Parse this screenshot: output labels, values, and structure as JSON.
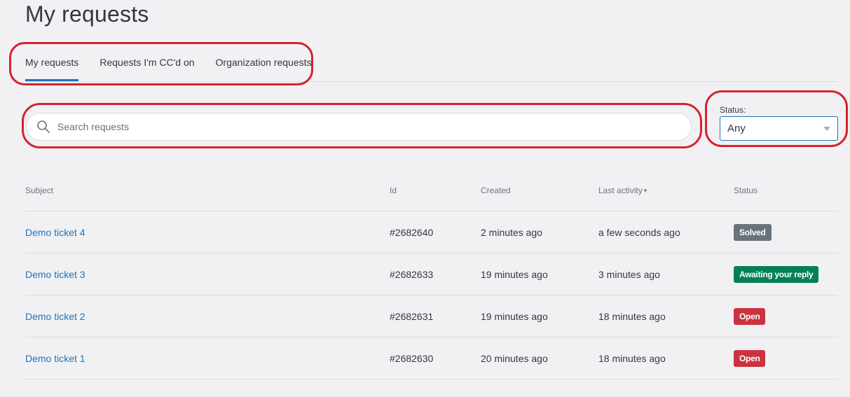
{
  "page": {
    "title": "My requests"
  },
  "tabs": [
    {
      "label": "My requests",
      "active": true
    },
    {
      "label": "Requests I'm CC'd on",
      "active": false
    },
    {
      "label": "Organization requests",
      "active": false
    }
  ],
  "search": {
    "placeholder": "Search requests",
    "value": "",
    "icon": "search-icon"
  },
  "status_filter": {
    "label": "Status:",
    "value": "Any"
  },
  "table": {
    "headers": {
      "subject": "Subject",
      "id": "Id",
      "created": "Created",
      "last_activity": "Last activity",
      "last_activity_sort": "▾",
      "status": "Status"
    },
    "rows": [
      {
        "subject": "Demo ticket 4",
        "id": "#2682640",
        "created": "2 minutes ago",
        "last_activity": "a few seconds ago",
        "status": "Solved",
        "status_color": "#68737d"
      },
      {
        "subject": "Demo ticket 3",
        "id": "#2682633",
        "created": "19 minutes ago",
        "last_activity": "3 minutes ago",
        "status": "Awaiting your reply",
        "status_color": "#038153"
      },
      {
        "subject": "Demo ticket 2",
        "id": "#2682631",
        "created": "19 minutes ago",
        "last_activity": "18 minutes ago",
        "status": "Open",
        "status_color": "#cc3340"
      },
      {
        "subject": "Demo ticket 1",
        "id": "#2682630",
        "created": "20 minutes ago",
        "last_activity": "18 minutes ago",
        "status": "Open",
        "status_color": "#cc3340"
      }
    ]
  },
  "colors": {
    "accent": "#1f73b7",
    "annotation": "#d8222b"
  }
}
